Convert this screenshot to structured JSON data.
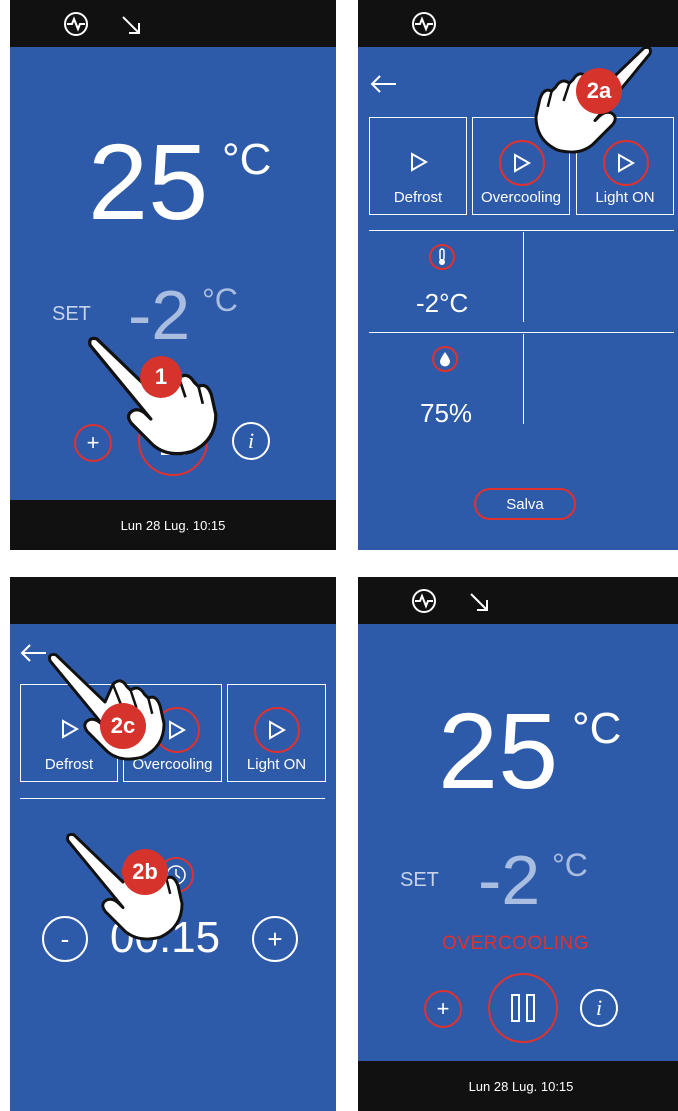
{
  "colors": {
    "screen_bg": "#2d5ba9",
    "bar_bg": "#111111",
    "accent_red": "#e0312f",
    "set_value": "#a9bde0"
  },
  "icons": {
    "activity": "activity-icon",
    "arrow_down_right": "arrow-down-right-icon",
    "back": "back-arrow-icon",
    "play": "play-icon",
    "thermometer": "thermometer-icon",
    "humidity": "humidity-drop-icon",
    "timer": "timer-icon",
    "info": "info-icon",
    "pause": "pause-icon",
    "hand": "pointing-hand-icon"
  },
  "panel1": {
    "temperature": "25",
    "temp_unit": "°C",
    "set_label": "SET",
    "set_value": "-2",
    "set_unit": "°C",
    "plus_label": "+",
    "info_label": "i",
    "step": "1",
    "date": "Lun 28 Lug. 10:15"
  },
  "panel2": {
    "step": "2a",
    "tiles": [
      {
        "label": "Defrost"
      },
      {
        "label": "Overcooling"
      },
      {
        "label": "Light ON"
      }
    ],
    "temp_value": "-2°C",
    "humidity_value": "75%",
    "save_label": "Salva"
  },
  "panel3": {
    "step_back": "2c",
    "step_minus": "2b",
    "tiles": [
      {
        "label": "Defrost"
      },
      {
        "label": "Overcooling"
      },
      {
        "label": "Light ON"
      }
    ],
    "minus_label": "-",
    "timer_value": "00:15",
    "plus_label": "+"
  },
  "panel4": {
    "temperature": "25",
    "temp_unit": "°C",
    "set_label": "SET",
    "set_value": "-2",
    "set_unit": "°C",
    "status": "OVERCOOLING",
    "plus_label": "+",
    "info_label": "i",
    "date": "Lun 28 Lug. 10:15"
  }
}
